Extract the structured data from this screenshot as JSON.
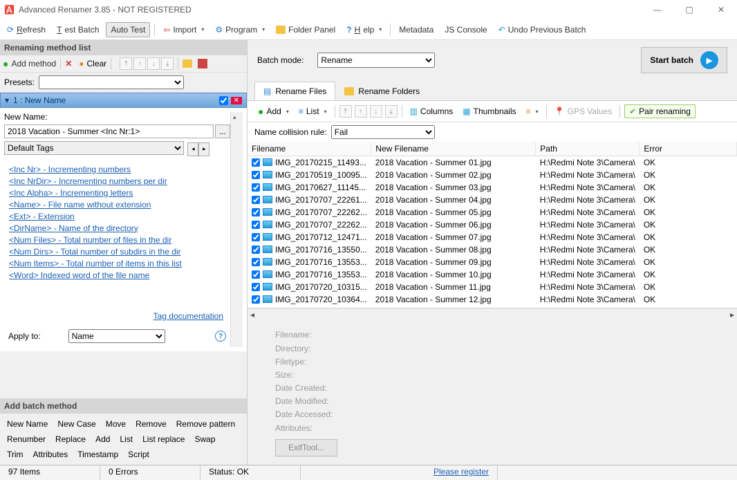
{
  "title": "Advanced Renamer 3.85 - NOT REGISTERED",
  "toolbar": {
    "refresh": "Refresh",
    "testbatch": "Test Batch",
    "autotest": "Auto Test",
    "import": "Import",
    "program": "Program",
    "folderpanel": "Folder Panel",
    "help": "Help",
    "metadata": "Metadata",
    "jsconsole": "JS Console",
    "undo": "Undo Previous Batch"
  },
  "left": {
    "header": "Renaming method list",
    "addmethod": "Add method",
    "clear": "Clear",
    "presets": "Presets:",
    "method_title": "1 : New Name",
    "newname_label": "New Name:",
    "newname_value": "2018 Vacation - Summer <Inc Nr:1>",
    "tags_select": "Default Tags",
    "tags": [
      "<Inc Nr> - Incrementing numbers",
      "<Inc NrDir> - Incrementing numbers per dir",
      "<Inc Alpha> - Incrementing letters",
      "<Name> - File name without extension",
      "<Ext> - Extension",
      "<DirName> - Name of the directory",
      "<Num Files> - Total number of files in the dir",
      "<Num Dirs> - Total number of subdirs in the dir",
      "<Num Items> - Total number of items in this list",
      "<Word> Indexed word of the file name"
    ],
    "tagdoc": "Tag documentation",
    "applyto_label": "Apply to:",
    "applyto_value": "Name"
  },
  "addbatch": {
    "header": "Add batch method",
    "items": [
      "New Name",
      "New Case",
      "Move",
      "Remove",
      "Remove pattern",
      "Renumber",
      "Replace",
      "Add",
      "List",
      "List replace",
      "Swap",
      "Trim",
      "Attributes",
      "Timestamp",
      "Script"
    ]
  },
  "right": {
    "batchmode_label": "Batch mode:",
    "batchmode_value": "Rename",
    "startbatch": "Start batch",
    "tab_files": "Rename Files",
    "tab_folders": "Rename Folders",
    "add": "Add",
    "list": "List",
    "columns": "Columns",
    "thumbs": "Thumbnails",
    "gps": "GPS Values",
    "pair": "Pair renaming",
    "collrule_label": "Name collision rule:",
    "collrule_value": "Fail",
    "cols": {
      "filename": "Filename",
      "newfilename": "New Filename",
      "path": "Path",
      "error": "Error"
    },
    "rows": [
      {
        "fn": "IMG_20170215_11493...",
        "nfn": "2018 Vacation - Summer 01.jpg",
        "p": "H:\\Redmi Note 3\\Camera\\",
        "e": "OK"
      },
      {
        "fn": "IMG_20170519_10095...",
        "nfn": "2018 Vacation - Summer 02.jpg",
        "p": "H:\\Redmi Note 3\\Camera\\",
        "e": "OK"
      },
      {
        "fn": "IMG_20170627_11145...",
        "nfn": "2018 Vacation - Summer 03.jpg",
        "p": "H:\\Redmi Note 3\\Camera\\",
        "e": "OK"
      },
      {
        "fn": "IMG_20170707_22261...",
        "nfn": "2018 Vacation - Summer 04.jpg",
        "p": "H:\\Redmi Note 3\\Camera\\",
        "e": "OK"
      },
      {
        "fn": "IMG_20170707_22262...",
        "nfn": "2018 Vacation - Summer 05.jpg",
        "p": "H:\\Redmi Note 3\\Camera\\",
        "e": "OK"
      },
      {
        "fn": "IMG_20170707_22262...",
        "nfn": "2018 Vacation - Summer 06.jpg",
        "p": "H:\\Redmi Note 3\\Camera\\",
        "e": "OK"
      },
      {
        "fn": "IMG_20170712_12471...",
        "nfn": "2018 Vacation - Summer 07.jpg",
        "p": "H:\\Redmi Note 3\\Camera\\",
        "e": "OK"
      },
      {
        "fn": "IMG_20170716_13550...",
        "nfn": "2018 Vacation - Summer 08.jpg",
        "p": "H:\\Redmi Note 3\\Camera\\",
        "e": "OK"
      },
      {
        "fn": "IMG_20170716_13553...",
        "nfn": "2018 Vacation - Summer 09.jpg",
        "p": "H:\\Redmi Note 3\\Camera\\",
        "e": "OK"
      },
      {
        "fn": "IMG_20170716_13553...",
        "nfn": "2018 Vacation - Summer 10.jpg",
        "p": "H:\\Redmi Note 3\\Camera\\",
        "e": "OK"
      },
      {
        "fn": "IMG_20170720_10315...",
        "nfn": "2018 Vacation - Summer 11.jpg",
        "p": "H:\\Redmi Note 3\\Camera\\",
        "e": "OK"
      },
      {
        "fn": "IMG_20170720_10364...",
        "nfn": "2018 Vacation - Summer 12.jpg",
        "p": "H:\\Redmi Note 3\\Camera\\",
        "e": "OK"
      }
    ],
    "details": [
      "Filename:",
      "Directory:",
      "Filetype:",
      "Size:",
      "Date Created:",
      "Date Modified:",
      "Date Accessed:",
      "Attributes:"
    ],
    "exif": "ExifTool..."
  },
  "status": {
    "items": "97 Items",
    "errors": "0 Errors",
    "status": "Status: OK",
    "register": "Please register"
  }
}
